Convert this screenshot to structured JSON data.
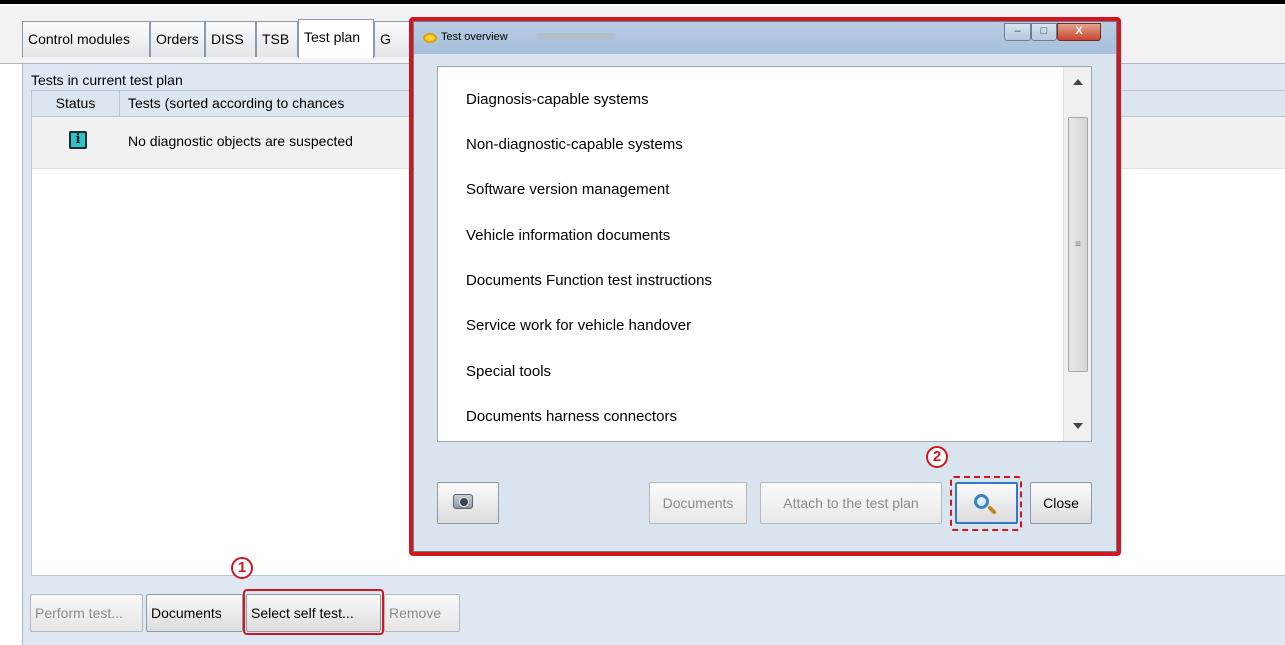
{
  "tabs": [
    {
      "label": "Control modules"
    },
    {
      "label": "Orders"
    },
    {
      "label": "DISS"
    },
    {
      "label": "TSB"
    },
    {
      "label": "Test plan"
    },
    {
      "label": "G"
    }
  ],
  "test_plan": {
    "group_title": "Tests in current test plan",
    "columns": {
      "status": "Status",
      "tests": "Tests (sorted according to chances"
    },
    "rows": [
      {
        "icon": "info-icon",
        "icon_glyph": "i",
        "text": "No diagnostic objects are suspected"
      }
    ]
  },
  "bottom_buttons": {
    "perform_test": "Perform test...",
    "documents": "Documents",
    "select_self_test": "Select self test...",
    "remove": "Remove"
  },
  "callouts": {
    "one": "1",
    "two": "2"
  },
  "dialog": {
    "title": "Test overview",
    "window_controls": {
      "minimize": "–",
      "maximize": "□",
      "close": "X"
    },
    "items": [
      "Diagnosis-capable systems",
      "Non-diagnostic-capable systems",
      "Software version management",
      "Vehicle information documents",
      "Documents Function test instructions",
      "Service work for vehicle handover",
      "Special tools",
      "Documents harness connectors"
    ],
    "buttons": {
      "documents": "Documents",
      "attach": "Attach to the test plan",
      "close": "Close"
    }
  },
  "colors": {
    "highlight": "#d0161f",
    "info_icon": "#2cc4c4"
  }
}
